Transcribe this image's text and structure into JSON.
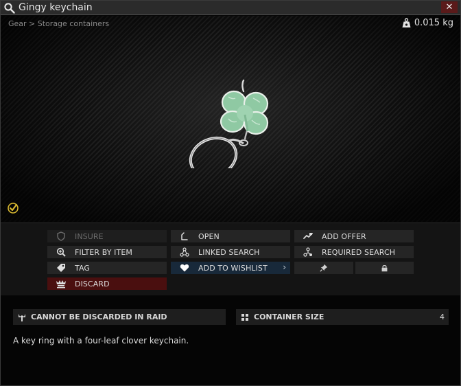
{
  "window": {
    "title": "Gingy keychain",
    "close_label": "✕"
  },
  "item": {
    "breadcrumb": "Gear > Storage containers",
    "weight": "0.015 kg"
  },
  "actions": {
    "insure": "INSURE",
    "open": "OPEN",
    "add_offer": "ADD OFFER",
    "filter_by_item": "FILTER BY ITEM",
    "linked_search": "LINKED SEARCH",
    "required_search": "REQUIRED SEARCH",
    "tag": "TAG",
    "add_to_wishlist": "ADD TO WISHLIST",
    "wishlist_chevron": "›",
    "discard": "DISCARD"
  },
  "properties": {
    "discard_restriction": "CANNOT BE DISCARDED IN RAID",
    "container_size_label": "CONTAINER SIZE",
    "container_size_value": "4"
  },
  "description": "A key ring with a four-leaf clover keychain.",
  "colors": {
    "discard_bg": "#4a0f0f",
    "wishlist_bg": "#18293a",
    "close_bg": "#5a1a1a",
    "check_accent": "#d8b830",
    "clover_green": "#8fc9a3"
  }
}
